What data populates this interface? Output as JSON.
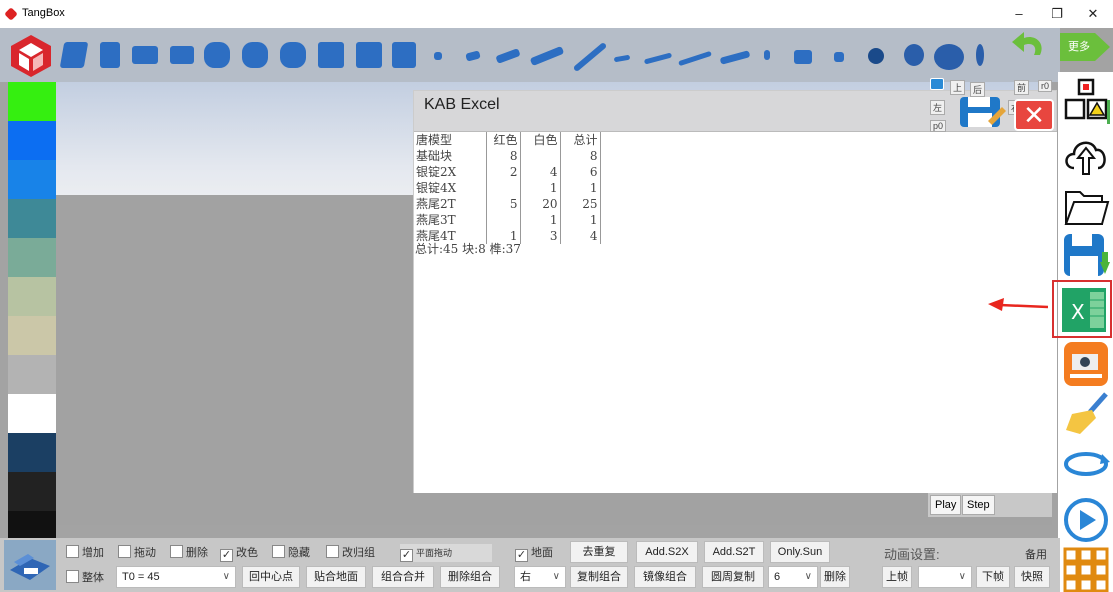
{
  "window": {
    "title": "TangBox",
    "minimize": "–",
    "restore": "❐",
    "close": "✕"
  },
  "toolbar": {
    "more_label": "更多"
  },
  "palette": [
    "#35ef10",
    "#0c6ef2",
    "#1883e8",
    "#3e8997",
    "#7aab98",
    "#b7c3a2",
    "#cbc7a8",
    "#b3b3b3",
    "#ffffff",
    "#1b3f63",
    "#222222",
    "#111111"
  ],
  "excel": {
    "title": "KAB Excel",
    "header": [
      "唐模型",
      "红色",
      "白色",
      "总计"
    ],
    "rows": [
      [
        "基础块",
        "8",
        "",
        "8"
      ],
      [
        "银锭2X",
        "2",
        "4",
        "6"
      ],
      [
        "银锭4X",
        "",
        "1",
        "1"
      ],
      [
        "燕尾2T",
        "5",
        "20",
        "25"
      ],
      [
        "燕尾3T",
        "",
        "1",
        "1"
      ],
      [
        "燕尾4T",
        "1",
        "3",
        "4"
      ]
    ],
    "summary": "总计:45  块:8  榫:37"
  },
  "viewcube": {
    "top": "上",
    "back": "后",
    "front": "前",
    "left": "左",
    "r0": "r0",
    "p0": "p0",
    "side": "右"
  },
  "playstep": {
    "play": "Play",
    "step": "Step"
  },
  "bottom": {
    "add": "增加",
    "drag": "拖动",
    "delete": "删除",
    "recolor": "改色",
    "hide": "隐藏",
    "regroup": "改归组",
    "plane_drag": "平面拖动",
    "ground": "地面",
    "dedupe": "去重复",
    "add_s2x": "Add.S2X",
    "add_s2t": "Add.S2T",
    "only_sun": "Only.Sun",
    "whole": "整体",
    "t0_value": "T0 = 45",
    "recenter": "回中心点",
    "stick_ground": "贴合地面",
    "merge_group": "组合合并",
    "delete_group": "删除组合",
    "direction": "右",
    "copy_group": "复制组合",
    "mirror_group": "镜像组合",
    "circular_copy": "圆周复制",
    "count": "6",
    "remove": "删除",
    "anim_settings": "动画设置:",
    "spare": "备用",
    "prev_frame": "上帧",
    "frame_select": "",
    "next_frame": "下帧",
    "snapshot": "快照"
  }
}
